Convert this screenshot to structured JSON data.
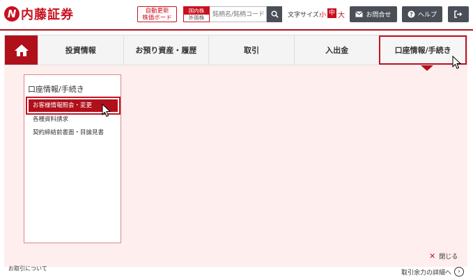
{
  "header": {
    "logo_mark": "N",
    "logo_text": "内藤証券",
    "auto_board_line1": "自動更新",
    "auto_board_line2": "株価ボード",
    "stock_toggle_on": "国内株",
    "stock_toggle_off": "外国株",
    "search_placeholder": "銘柄名/銘柄コード",
    "font_size_label": "文字サイズ:",
    "font_small": "小",
    "font_mid": "中",
    "font_large": "大",
    "contact_label": "お問合せ",
    "help_label": "ヘルプ"
  },
  "nav": {
    "items": [
      {
        "label": "投資情報"
      },
      {
        "label": "お預り資産・履歴"
      },
      {
        "label": "取引"
      },
      {
        "label": "入出金"
      },
      {
        "label": "口座情報/手続き"
      }
    ]
  },
  "submenu": {
    "title": "口座情報/手続き",
    "items": [
      {
        "label": "お客様情報照会・変更"
      },
      {
        "label": "各種資料請求"
      },
      {
        "label": "契約締結前書面・目論見書"
      }
    ],
    "close_label": "閉じる"
  },
  "background": {
    "link_text": "お取引について",
    "detail_text": "取引余力の詳細へ"
  },
  "colors": {
    "brand_red": "#b0101a",
    "panel_bg": "#ffeeee",
    "dark_button": "#4a4f57"
  }
}
